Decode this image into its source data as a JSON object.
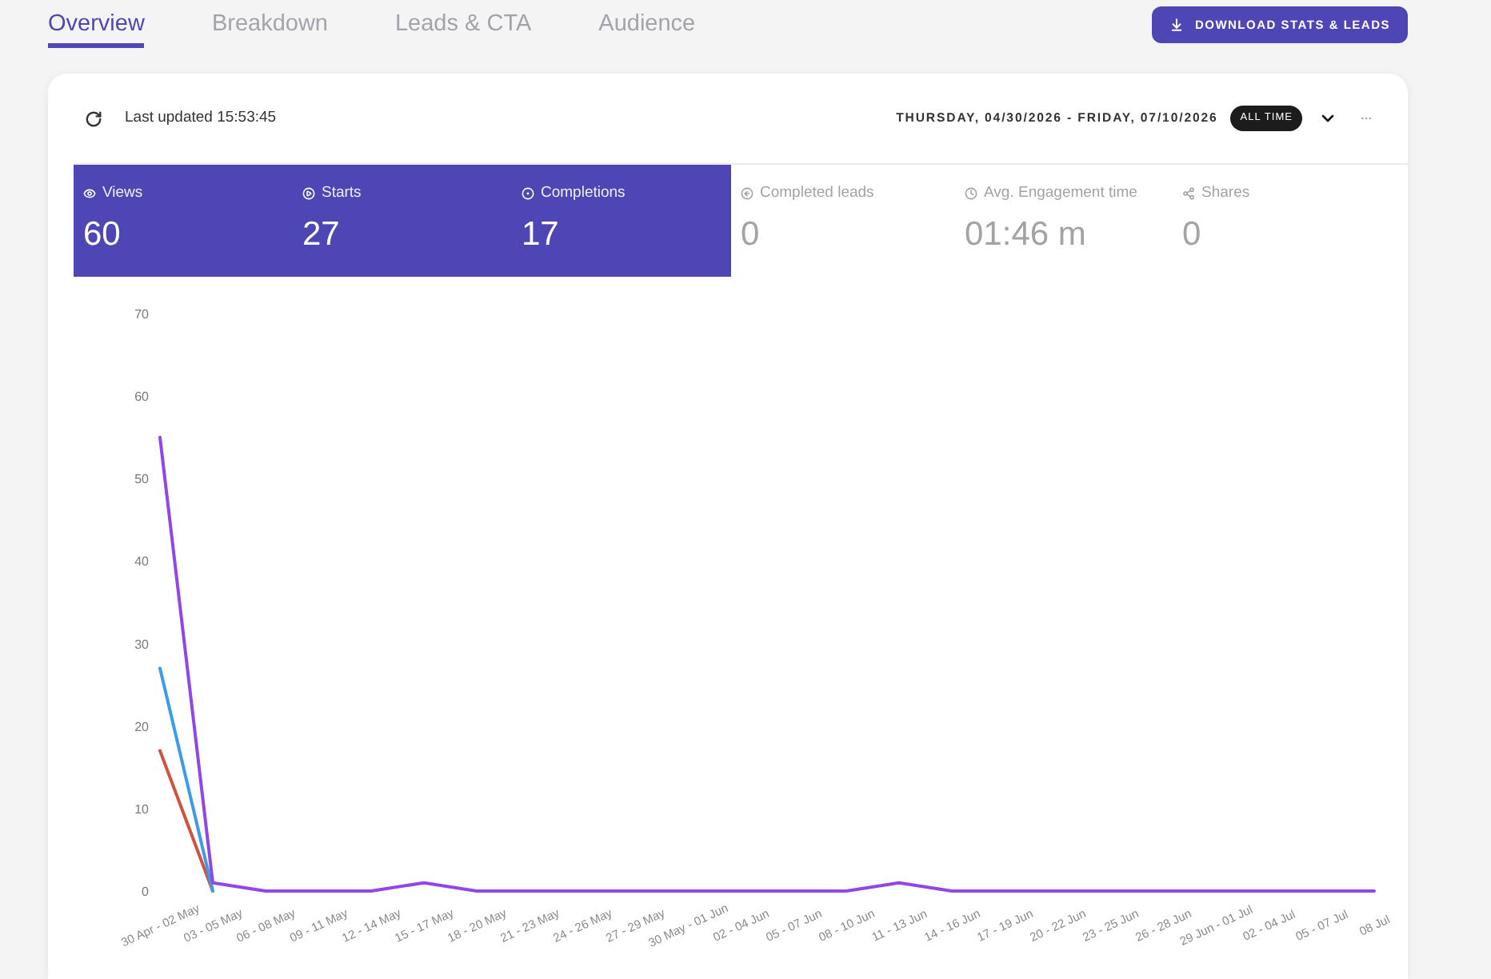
{
  "tabs": [
    {
      "label": "Overview",
      "selected": true
    },
    {
      "label": "Breakdown",
      "selected": false
    },
    {
      "label": "Leads & CTA",
      "selected": false
    },
    {
      "label": "Audience",
      "selected": false
    }
  ],
  "download_button": {
    "label": "DOWNLOAD STATS & LEADS"
  },
  "header": {
    "last_updated": "Last updated 15:53:45",
    "date_range": "THURSDAY, 04/30/2026 - FRIDAY, 07/10/2026",
    "range_badge": "ALL TIME"
  },
  "stats": [
    {
      "kind": "views",
      "label": "Views",
      "value": "60",
      "selected": true
    },
    {
      "kind": "starts",
      "label": "Starts",
      "value": "27",
      "selected": true
    },
    {
      "kind": "completions",
      "label": "Completions",
      "value": "17",
      "selected": true
    },
    {
      "kind": "leads",
      "label": "Completed leads",
      "value": "0",
      "selected": false
    },
    {
      "kind": "time",
      "label": "Avg. Engagement time",
      "value": "01:46 m",
      "selected": false
    },
    {
      "kind": "shares",
      "label": "Shares",
      "value": "0",
      "selected": false
    }
  ],
  "chart": {
    "chart_data": {
      "type": "line",
      "categories": [
        "30 Apr - 02 May",
        "03 - 05 May",
        "06 - 08 May",
        "09 - 11 May",
        "12 - 14 May",
        "15 - 17 May",
        "18 - 20 May",
        "21 - 23 May",
        "24 - 26 May",
        "27 - 29 May",
        "30 May - 01 Jun",
        "02 - 04 Jun",
        "05 - 07 Jun",
        "08 - 10 Jun",
        "11 - 13 Jun",
        "14 - 16 Jun",
        "17 - 19 Jun",
        "20 - 22 Jun",
        "23 - 25 Jun",
        "26 - 28 Jun",
        "29 Jun - 01 Jul",
        "02 - 04 Jul",
        "05 - 07 Jul",
        "08 Jul"
      ],
      "ylim": [
        0,
        70
      ],
      "yticks": [
        0,
        10,
        20,
        30,
        40,
        50,
        60,
        70
      ],
      "series": [
        {
          "color": "#d0533f",
          "values": [
            17,
            0,
            null,
            null,
            null,
            null,
            null,
            null,
            null,
            null,
            null,
            null,
            null,
            null,
            null,
            null,
            null,
            null,
            null,
            null,
            null,
            null,
            null,
            null
          ]
        },
        {
          "color": "#3d9be9",
          "values": [
            27,
            0,
            null,
            null,
            null,
            null,
            null,
            null,
            null,
            null,
            null,
            null,
            null,
            null,
            null,
            null,
            null,
            null,
            null,
            null,
            null,
            null,
            null,
            null
          ]
        },
        {
          "color": "#9146e8",
          "values": [
            55,
            1,
            0,
            0,
            0,
            1,
            0,
            0,
            0,
            0,
            0,
            0,
            0,
            0,
            1,
            0,
            0,
            0,
            0,
            0,
            0,
            0,
            0,
            0
          ]
        }
      ]
    }
  }
}
